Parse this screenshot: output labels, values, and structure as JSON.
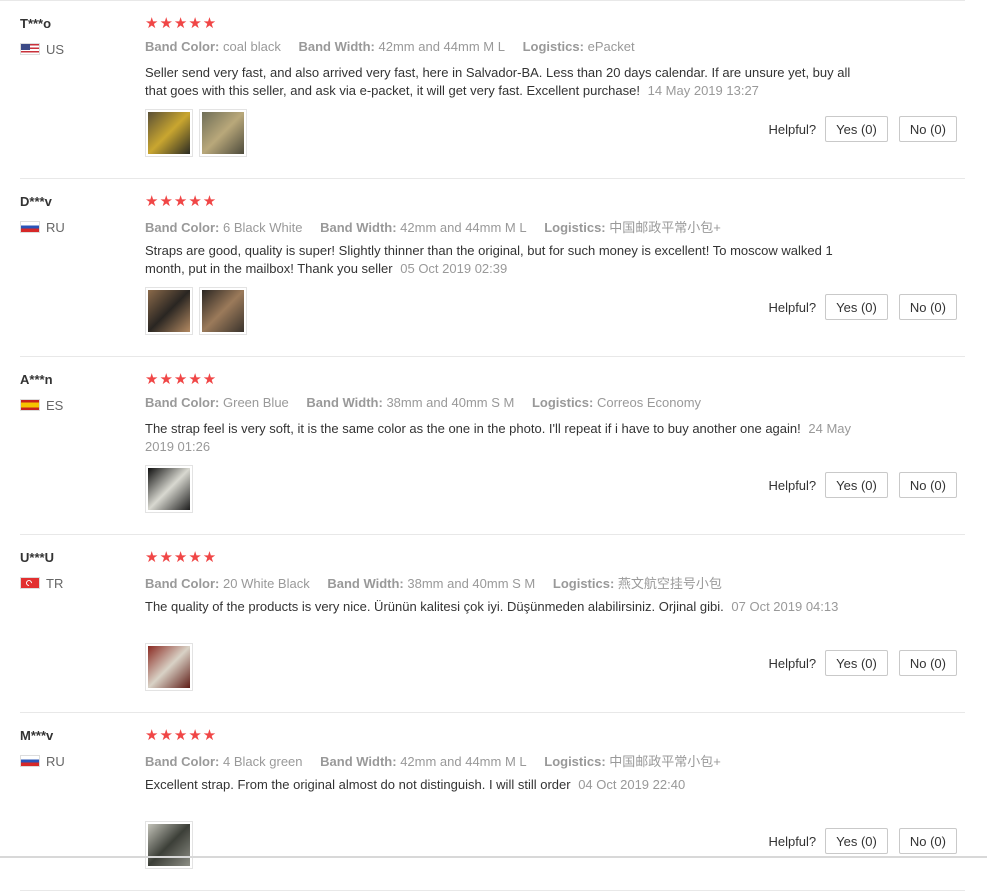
{
  "labels": {
    "band_color": "Band Color:",
    "band_width": "Band Width:",
    "logistics": "Logistics:",
    "helpful": "Helpful?"
  },
  "rating_stars": "★★★★★",
  "reviews": [
    {
      "user": "T***o",
      "country": "US",
      "flag": "flag-us",
      "band_color": "coal black",
      "band_width": "42mm and 44mm M L",
      "logistics": "ePacket",
      "comment": "Seller send very fast, and also arrived very fast, here in Salvador-BA. Less than 20 days calendar. If are unsure yet, buy all that goes with this seller, and ask via e-packet, it will get very fast. Excellent purchase!",
      "date": "14 May 2019 13:27",
      "yes": "Yes (0)",
      "no": "No (0)",
      "photos": [
        {
          "desc": "phone-photo",
          "colors": [
            "#5a5036",
            "#c9a630",
            "#2b2b23"
          ]
        },
        {
          "desc": "straps-photo",
          "colors": [
            "#6f6e57",
            "#b9a87a",
            "#4d4b3c"
          ]
        }
      ]
    },
    {
      "user": "D***v",
      "country": "RU",
      "flag": "flag-ru",
      "band_color": "6 Black White",
      "band_width": "42mm and 44mm M L",
      "logistics": "中国邮政平常小包+",
      "comment": "Straps are good, quality is super! Slightly thinner than the original, but for such money is excellent! To moscow walked 1 month, put in the mailbox! Thank you seller",
      "date": "05 Oct 2019 02:39",
      "yes": "Yes (0)",
      "no": "No (0)",
      "photos": [
        {
          "desc": "strap-photo",
          "colors": [
            "#8b6a4a",
            "#2a2622",
            "#b48a62"
          ]
        },
        {
          "desc": "strap-photo",
          "colors": [
            "#2a2622",
            "#9b7a5a",
            "#3a332c"
          ]
        }
      ]
    },
    {
      "user": "A***n",
      "country": "ES",
      "flag": "flag-es",
      "band_color": "Green Blue",
      "band_width": "38mm and 40mm S M",
      "logistics": "Correos Economy",
      "comment": "The strap feel is very soft, it is the same color as the one in the photo. I'll repeat if i have to buy another one again!",
      "date": "24 May 2019 01:26",
      "yes": "Yes (0)",
      "no": "No (0)",
      "photos": [
        {
          "desc": "package-photo",
          "colors": [
            "#0e0e0e",
            "#d8d8d0",
            "#1c1c1c"
          ]
        }
      ]
    },
    {
      "user": "U***U",
      "country": "TR",
      "flag": "flag-tr",
      "band_color": "20 White Black",
      "band_width": "38mm and 40mm S M",
      "logistics": "燕文航空挂号小包",
      "comment": "The quality of the products is very nice. Ürünün kalitesi çok iyi. Düşünmeden alabilirsiniz. Orjinal gibi.",
      "date": "07 Oct 2019 04:13",
      "yes": "Yes (0)",
      "no": "No (0)",
      "photos": [
        {
          "desc": "strap-photo",
          "colors": [
            "#8a2a22",
            "#d9d2c6",
            "#5e1c16"
          ]
        }
      ]
    },
    {
      "user": "M***v",
      "country": "RU",
      "flag": "flag-ru",
      "band_color": "4 Black green",
      "band_width": "42mm and 44mm M L",
      "logistics": "中国邮政平常小包+",
      "comment": "Excellent strap. From the original almost do not distinguish. I will still order",
      "date": "04 Oct 2019 22:40",
      "yes": "Yes (0)",
      "no": "No (0)",
      "photos": [
        {
          "desc": "watch-photo",
          "colors": [
            "#c2c2b8",
            "#3c3f38",
            "#8e8f86"
          ]
        }
      ]
    }
  ]
}
